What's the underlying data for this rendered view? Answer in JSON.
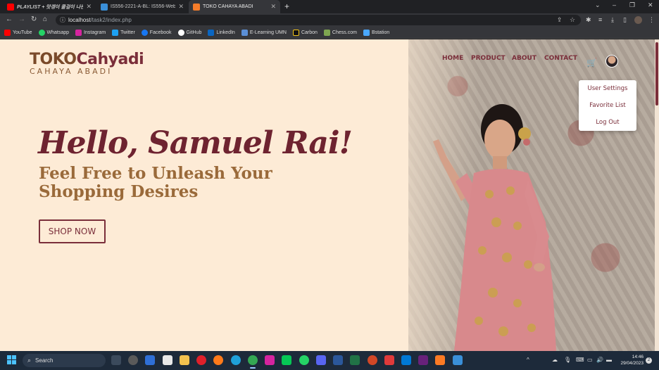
{
  "browser": {
    "tabs": [
      {
        "title": "PLAYLIST + 맛갱이 쿨걸이 나는",
        "fav_color": "#ff0000",
        "active": false
      },
      {
        "title": "IS556-2221-A-BL: IS556-Web De",
        "fav_color": "#3a8fd8",
        "active": false
      },
      {
        "title": "TOKO CAHAYA ABADI",
        "fav_color": "#f57c2a",
        "active": true
      }
    ],
    "new_tab_label": "+",
    "window_controls": [
      "⌄",
      "–",
      "❐",
      "✕"
    ],
    "url_host": "localhost",
    "url_path": "/task2/index.php",
    "bookmarks": [
      {
        "label": "YouTube",
        "color": "#ff0000"
      },
      {
        "label": "Whatsapp",
        "color": "#25d366"
      },
      {
        "label": "Instagram",
        "color": "#d6249f"
      },
      {
        "label": "Twitter",
        "color": "#1da1f2"
      },
      {
        "label": "Facebook",
        "color": "#1877f2"
      },
      {
        "label": "GitHub",
        "color": "#ffffff"
      },
      {
        "label": "LinkedIn",
        "color": "#0a66c2"
      },
      {
        "label": "E-Learning UMN",
        "color": "#5b8fd6"
      },
      {
        "label": "Carbon",
        "color": "#f5c518"
      },
      {
        "label": "Chess.com",
        "color": "#7fa650"
      },
      {
        "label": "Bstation",
        "color": "#4aa8ff"
      }
    ]
  },
  "site": {
    "logo_toko": "TOKO",
    "logo_cahyadi": "Cahyadi",
    "logo_sub": "CAHAYA ABADI",
    "nav": {
      "home": "HOME",
      "product": "PRODUCT",
      "about": "ABOUT",
      "contact": "CONTACT"
    },
    "dropdown": {
      "user_settings": "User Settings",
      "favorite_list": "Favorite List",
      "log_out": "Log Out"
    },
    "hero": {
      "greeting": "Hello, Samuel Rai!",
      "tagline": "Feel Free to Unleash Your Shopping Desires",
      "cta": "SHOP NOW"
    },
    "colors": {
      "accent": "#7a2e3a",
      "background": "#fdebd6",
      "gold": "#9a6a3a"
    }
  },
  "taskbar": {
    "search_placeholder": "Search",
    "time": "14:46",
    "date": "29/04/2023",
    "notification_count": "2"
  }
}
